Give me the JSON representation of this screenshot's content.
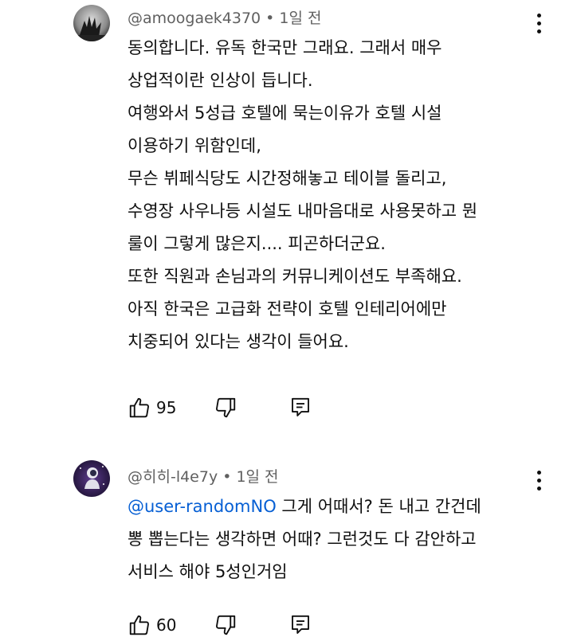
{
  "comments": [
    {
      "username": "@amoogaek4370",
      "time": "1일 전",
      "lines": [
        "동의합니다. 유독 한국만 그래요. 그래서 매우",
        "상업적이란 인상이 듭니다.",
        "여행와서 5성급 호텔에 묵는이유가 호텔 시설",
        "이용하기 위함인데,",
        "무슨 뷔페식당도 시간정해놓고 테이블 돌리고,",
        "수영장 사우나등 시설도 내마음대로 사용못하고 뭔",
        "룰이 그렇게 많은지.... 피곤하더군요.",
        "또한 직원과 손님과의 커뮤니케이션도 부족해요.",
        "아직 한국은 고급화 전략이 호텔 인테리어에만",
        "치중되어 있다는 생각이 들어요."
      ],
      "likes": "95"
    },
    {
      "username": "@히히-l4e7y",
      "time": "1일 전",
      "mention": "@user-randomNO",
      "lines": [
        " 그게 어때서? 돈 내고 간건데",
        "뽕 뽑는다는 생각하면 어때? 그런것도 다 감안하고",
        "서비스 해야 5성인거임"
      ],
      "likes": "60"
    }
  ],
  "icons": {
    "like": "thumbs-up-icon",
    "dislike": "thumbs-down-icon",
    "reply": "reply-icon",
    "menu": "more-vert-icon"
  },
  "colors": {
    "text": "#0f0f0f",
    "meta": "#606060",
    "mention": "#065fd4"
  }
}
